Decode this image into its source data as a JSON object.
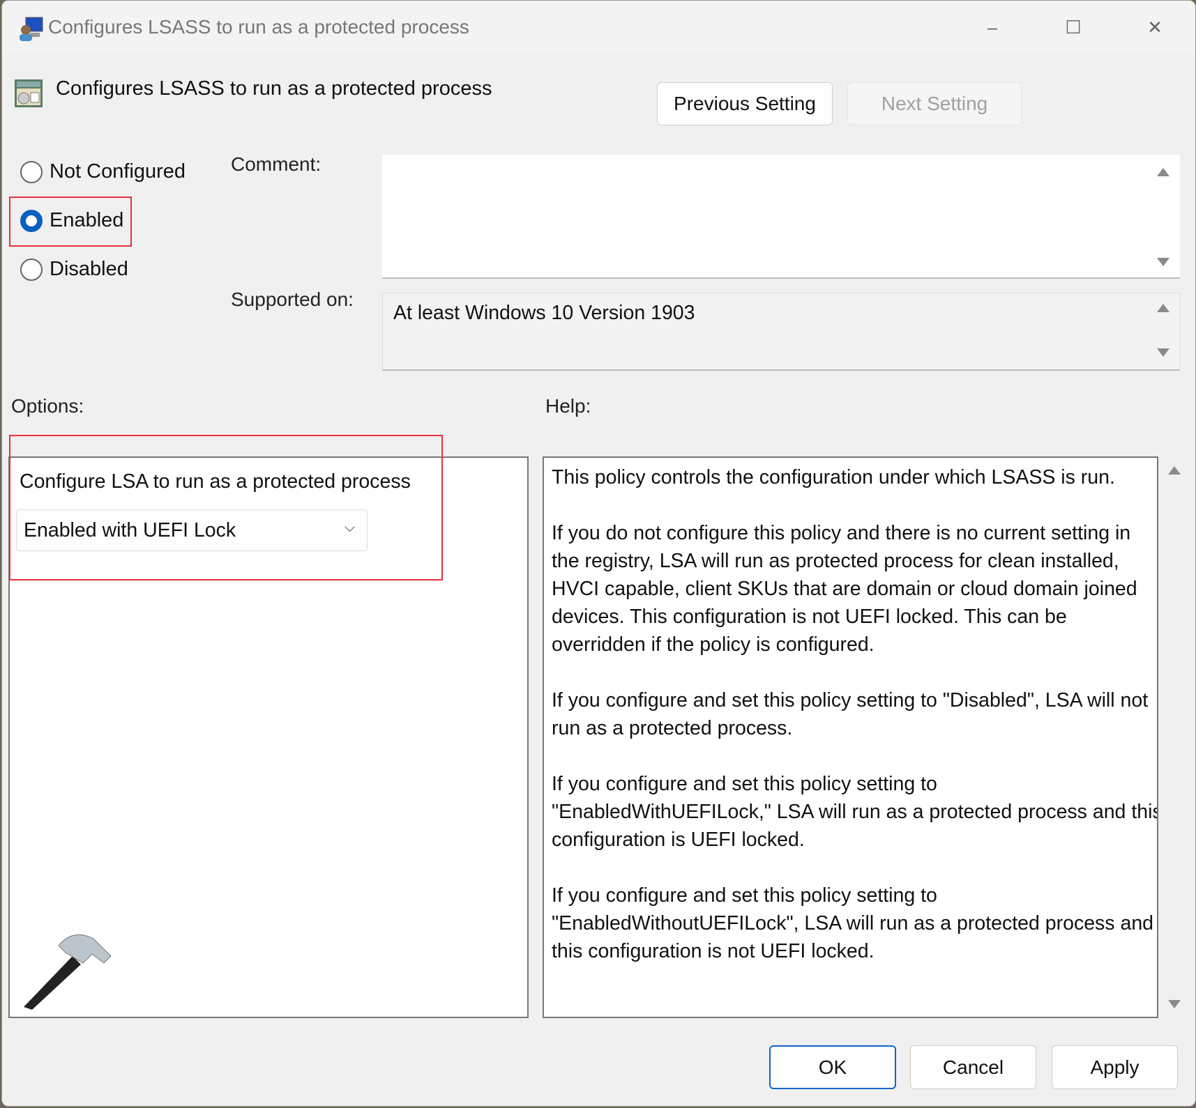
{
  "window": {
    "title": "Configures LSASS to run as a protected process",
    "minimize_icon": "minimize-icon",
    "maximize_icon": "maximize-icon",
    "close_icon": "close-icon"
  },
  "header": {
    "title": "Configures LSASS to run as a protected process",
    "previous_label": "Previous Setting",
    "next_label": "Next Setting"
  },
  "state": {
    "options": [
      {
        "label": "Not Configured",
        "selected": false
      },
      {
        "label": "Enabled",
        "selected": true
      },
      {
        "label": "Disabled",
        "selected": false
      }
    ]
  },
  "comment": {
    "label": "Comment:",
    "value": ""
  },
  "supported": {
    "label": "Supported on:",
    "value": "At least Windows 10 Version 1903"
  },
  "options": {
    "label": "Options:",
    "setting_label": "Configure LSA to run as a protected process",
    "dropdown_value": "Enabled with UEFI Lock"
  },
  "help": {
    "label": "Help:",
    "paragraphs": [
      [
        "This policy controls the configuration under which LSASS is run."
      ],
      [
        "If you do not configure this policy and there is no current setting in",
        "the registry, LSA will run as protected process for clean installed,",
        "HVCI capable, client SKUs that are domain or cloud domain joined",
        "devices. This configuration is not UEFI locked. This can be",
        "overridden if the policy is configured."
      ],
      [
        "If you configure and set this policy setting to \"Disabled\", LSA will not",
        "run as a protected process."
      ],
      [
        "If you configure and set this policy setting to",
        "\"EnabledWithUEFILock,\" LSA will run as a protected process and this",
        "configuration is UEFI locked."
      ],
      [
        "If you configure and set this policy setting to",
        "\"EnabledWithoutUEFILock\", LSA will run as a protected process and",
        "this configuration is not UEFI locked."
      ]
    ]
  },
  "footer": {
    "ok": "OK",
    "cancel": "Cancel",
    "apply": "Apply"
  },
  "colors": {
    "accent": "#0a5fbf",
    "highlight": "#e5323b"
  }
}
